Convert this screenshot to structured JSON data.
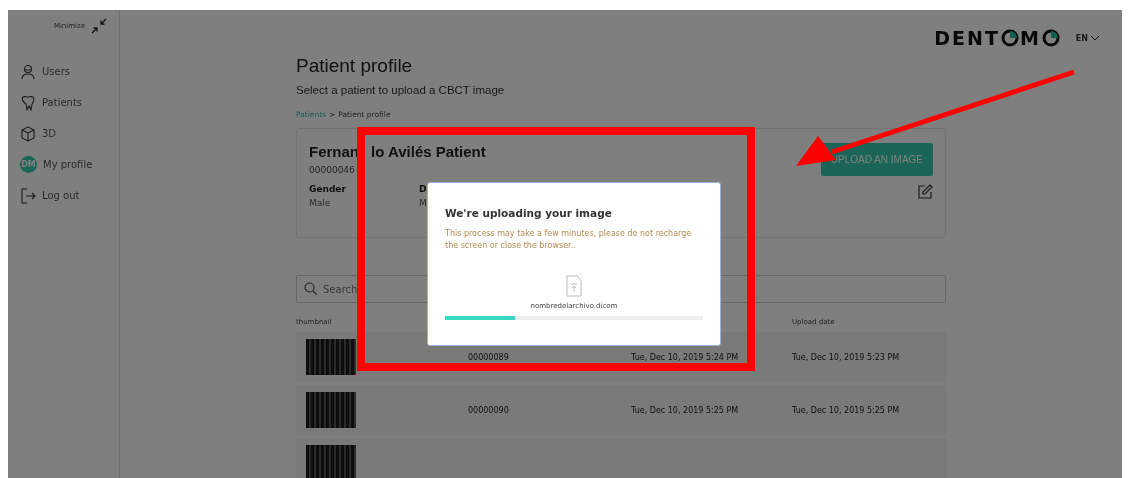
{
  "sidebar": {
    "minimize_label": "Minimize",
    "items": [
      {
        "kind": "users",
        "label": "Users",
        "selected": false
      },
      {
        "kind": "patients",
        "label": "Patients",
        "selected": false
      },
      {
        "kind": "cube",
        "label": "3D",
        "selected": false
      },
      {
        "kind": "avatar",
        "label": "My profile",
        "avatar_text": "DM",
        "selected": false
      },
      {
        "kind": "logout",
        "label": "Log out",
        "selected": false
      }
    ]
  },
  "header": {
    "logo_parts": [
      "DENT",
      "M"
    ],
    "language": "EN"
  },
  "page": {
    "title": "Patient profile",
    "subtitle": "Select a patient to upload a CBCT image",
    "breadcrumb": {
      "link": "Patients",
      "separator": ">",
      "current": "Patient profile"
    }
  },
  "patient_card": {
    "name_before": "Fernan",
    "name_after": "lo Avilés Patient",
    "id": "00000046",
    "upload_button": "UPLOAD AN IMAGE",
    "fields": [
      {
        "label": "Gender",
        "value": "Male"
      },
      {
        "label": "D",
        "value": "M"
      }
    ]
  },
  "search": {
    "placeholder": "Search"
  },
  "table": {
    "column_1": "thumbnail",
    "column_4": "Upload date",
    "rows": [
      {
        "kind": "xray",
        "id": "00000089",
        "created": "Tue, Dec 10, 2019 5:24 PM",
        "uploaded": "Tue, Dec 10, 2019 5:23 PM"
      },
      {
        "kind": "xray",
        "id": "00000090",
        "created": "Tue, Dec 10, 2019 5:25 PM",
        "uploaded": "Tue, Dec 10, 2019 5:25 PM"
      },
      {
        "kind": "xray"
      }
    ]
  },
  "modal": {
    "title": "We're uploading your image",
    "message": "This process may take a few minutes, please do not recharge the screen or close the browser..",
    "file_name": "nombredelarchivo.dicom",
    "level": 0.27
  }
}
